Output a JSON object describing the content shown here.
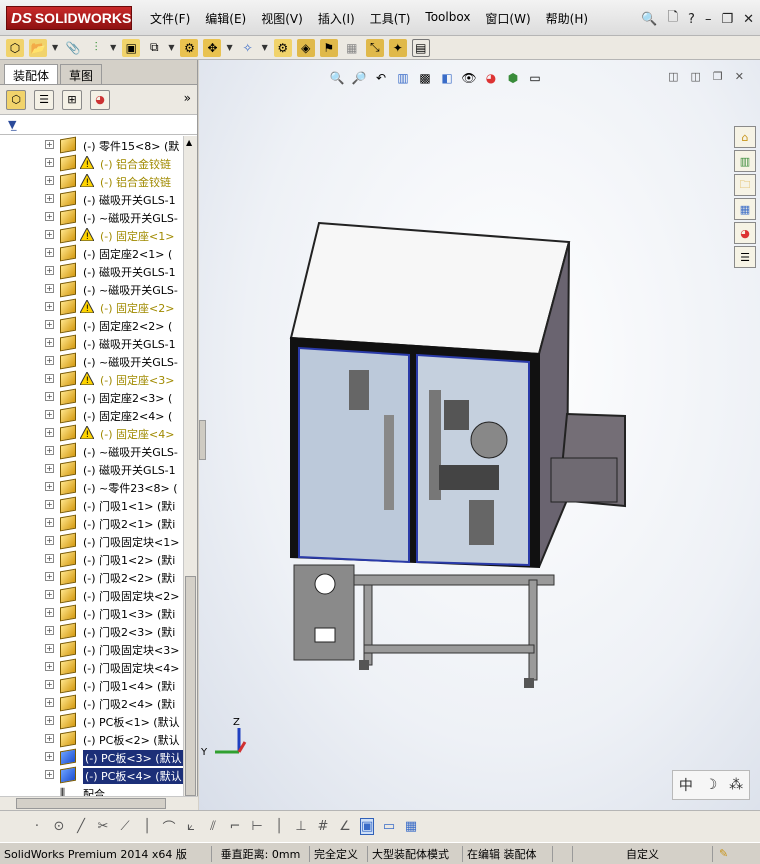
{
  "title_bar": {
    "logo": {
      "prefix": "DS",
      "name": "SOLIDWORKS"
    },
    "menus": [
      "文件(F)",
      "编辑(E)",
      "视图(V)",
      "插入(I)",
      "工具(T)",
      "Toolbox",
      "窗口(W)",
      "帮助(H)"
    ],
    "help_label": "?"
  },
  "left_panel": {
    "tabs": [
      "装配体",
      "草图"
    ],
    "tree": [
      {
        "label": "(-) 零件15<8> (默",
        "warn": false
      },
      {
        "label": "(-) 铝合金铰链",
        "warn": true
      },
      {
        "label": "(-) 铝合金铰链",
        "warn": true
      },
      {
        "label": "(-) 磁吸开关GLS-1",
        "warn": false
      },
      {
        "label": "(-) ~磁吸开关GLS-",
        "warn": false
      },
      {
        "label": "(-) 固定座<1>",
        "warn": true
      },
      {
        "label": "(-) 固定座2<1> (",
        "warn": false
      },
      {
        "label": "(-) 磁吸开关GLS-1",
        "warn": false
      },
      {
        "label": "(-) ~磁吸开关GLS-",
        "warn": false
      },
      {
        "label": "(-) 固定座<2>",
        "warn": true
      },
      {
        "label": "(-) 固定座2<2> (",
        "warn": false
      },
      {
        "label": "(-) 磁吸开关GLS-1",
        "warn": false
      },
      {
        "label": "(-) ~磁吸开关GLS-",
        "warn": false
      },
      {
        "label": "(-) 固定座<3>",
        "warn": true
      },
      {
        "label": "(-) 固定座2<3> (",
        "warn": false
      },
      {
        "label": "(-) 固定座2<4> (",
        "warn": false
      },
      {
        "label": "(-) 固定座<4>",
        "warn": true
      },
      {
        "label": "(-) ~磁吸开关GLS-",
        "warn": false
      },
      {
        "label": "(-) 磁吸开关GLS-1",
        "warn": false
      },
      {
        "label": "(-) ~零件23<8> (",
        "warn": false
      },
      {
        "label": "(-) 门吸1<1> (默i",
        "warn": false
      },
      {
        "label": "(-) 门吸2<1> (默i",
        "warn": false
      },
      {
        "label": "(-) 门吸固定块<1>",
        "warn": false
      },
      {
        "label": "(-) 门吸1<2> (默i",
        "warn": false
      },
      {
        "label": "(-) 门吸2<2> (默i",
        "warn": false
      },
      {
        "label": "(-) 门吸固定块<2>",
        "warn": false
      },
      {
        "label": "(-) 门吸1<3> (默i",
        "warn": false
      },
      {
        "label": "(-) 门吸2<3> (默i",
        "warn": false
      },
      {
        "label": "(-) 门吸固定块<3>",
        "warn": false
      },
      {
        "label": "(-) 门吸固定块<4>",
        "warn": false
      },
      {
        "label": "(-) 门吸1<4> (默i",
        "warn": false
      },
      {
        "label": "(-) 门吸2<4> (默i",
        "warn": false
      },
      {
        "label": "(-) PC板<1> (默认",
        "warn": false
      },
      {
        "label": "(-) PC板<2> (默认",
        "warn": false
      },
      {
        "label": "(-) PC板<3> (默认",
        "warn": false,
        "selected": true
      },
      {
        "label": "(-) PC板<4> (默认",
        "warn": false,
        "selected": true
      },
      {
        "label": "配合",
        "warn": false,
        "mates": true
      }
    ]
  },
  "viewport": {
    "triad": {
      "z": "Z",
      "y": "Y"
    },
    "ime": [
      "中",
      "☽",
      "⁂"
    ]
  },
  "status_bar": {
    "app": "SolidWorks Premium 2014 x64 版",
    "distance": "垂直距离: 0mm",
    "defined": "完全定义",
    "mode": "大型装配体模式",
    "editing": "在编辑 装配体",
    "custom": "自定义"
  }
}
